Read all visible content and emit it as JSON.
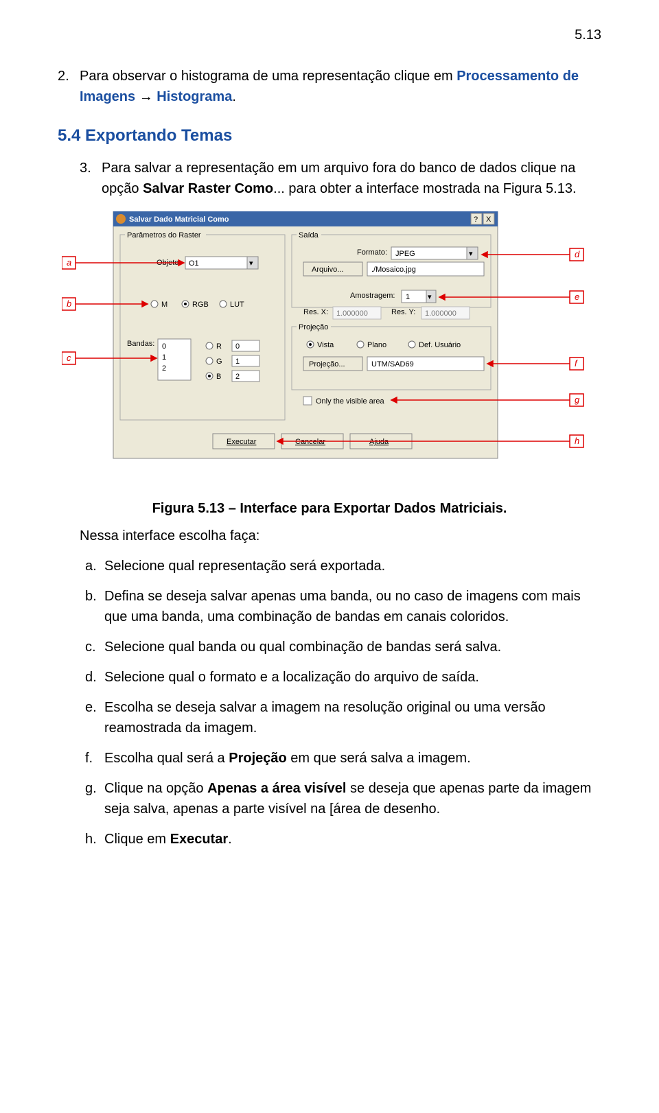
{
  "page_number": "5.13",
  "p2_num": "2.",
  "p2_a": "Para observar o histograma de uma representação clique em ",
  "p2_b": "Processamento de Imagens",
  "p2_c": " → ",
  "p2_d": "Histograma",
  "p2_e": ".",
  "h2": "5.4  Exportando Temas",
  "p3_num": "3.",
  "p3_a": "Para salvar a representação em um arquivo fora do banco de dados clique na opção ",
  "p3_b": "Salvar Raster Como",
  "p3_c": "... para obter a interface mostrada na Figura 5.13.",
  "caption": "Figura 5.13 – Interface para Exportar Dados Matriciais.",
  "intro": "Nessa interface escolha faça:",
  "a_n": "a.",
  "a": "Selecione qual representação será exportada.",
  "b_n": "b.",
  "b": "Defina se deseja salvar apenas uma banda, ou no caso de imagens com mais que uma banda, uma combinação de bandas em canais coloridos.",
  "c_n": "c.",
  "c": "Selecione qual banda ou qual combinação de bandas será salva.",
  "d_n": "d.",
  "d": "Selecione qual o formato e a localização do arquivo de saída.",
  "e_n": "e.",
  "e": "Escolha se deseja salvar a imagem na resolução original ou uma versão reamostrada da imagem.",
  "f_n": "f.",
  "f_a": "Escolha qual será a ",
  "f_b": "Projeção",
  "f_c": " em que será salva a imagem.",
  "g_n": "g.",
  "g_a": "Clique na opção ",
  "g_b": "Apenas a área visível",
  "g_c": " se deseja que apenas parte da imagem seja salva, apenas a parte visível na [área de desenho.",
  "h_n": "h.",
  "h_a": "Clique em ",
  "h_b": "Executar",
  "h_c": ".",
  "fig": {
    "title": "Salvar Dado Matricial Como",
    "grp_param": "Parâmetros do Raster",
    "grp_saida": "Saída",
    "grp_proj": "Projeção",
    "lbl_objeto": "Objeto:",
    "val_objeto": "O1",
    "rad_m": "M",
    "rad_rgb": "RGB",
    "rad_lut": "LUT",
    "lbl_bandas": "Bandas:",
    "b0": "0",
    "b1": "1",
    "b2": "2",
    "rad_r": "R",
    "rad_g": "G",
    "rad_b": "B",
    "vr": "0",
    "vg": "1",
    "vb": "2",
    "lbl_formato": "Formato:",
    "val_formato": "JPEG",
    "btn_arquivo": "Arquivo...",
    "val_arquivo": "./Mosaico.jpg",
    "lbl_amostragem": "Amostragem:",
    "val_amostragem": "1",
    "lbl_resx": "Res. X:",
    "val_resx": "1.000000",
    "lbl_resy": "Res. Y:",
    "val_resy": "1.000000",
    "rad_vista": "Vista",
    "rad_plano": "Plano",
    "rad_def": "Def. Usuário",
    "btn_proj": "Projeção...",
    "val_proj": "UTM/SAD69",
    "chk_vis": "Only the visible area",
    "btn_exec": "Executar",
    "btn_cancel": "Cancelar",
    "btn_ajuda": "Ajuda",
    "call_a": "a",
    "call_b": "b",
    "call_c": "c",
    "call_d": "d",
    "call_e": "e",
    "call_f": "f",
    "call_g": "g",
    "call_h": "h"
  }
}
